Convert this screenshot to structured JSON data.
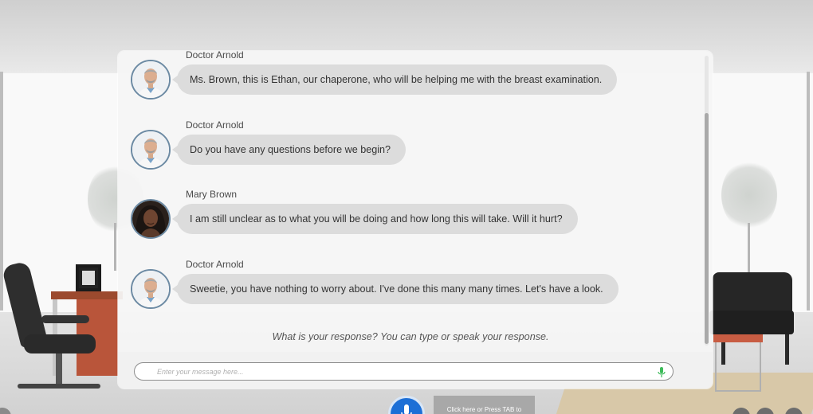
{
  "messages": [
    {
      "sender": "Doctor Arnold",
      "text": "Ms. Brown, this is Ethan, our chaperone, who will be helping me with the breast examination.",
      "avatar": "doctor-avatar"
    },
    {
      "sender": "Doctor Arnold",
      "text": "Do you have any questions before we begin?",
      "avatar": "doctor-avatar"
    },
    {
      "sender": "Mary Brown",
      "text": "I am still unclear as to what you will be doing and how long this will take. Will it hurt?",
      "avatar": "patient-avatar"
    },
    {
      "sender": "Doctor Arnold",
      "text": "Sweetie, you have nothing to worry about. I've done this many many times. Let's have a look.",
      "avatar": "doctor-avatar"
    }
  ],
  "prompt": "What is your response? You can type or speak your response.",
  "input": {
    "placeholder": "Enter your message here...",
    "value": "",
    "mic_icon": "microphone-icon"
  },
  "controls": {
    "voice_button_icon": "microphone-icon",
    "tab_hint": "Click here or Press TAB to"
  },
  "colors": {
    "bubble": "#dcdcdc",
    "mic_green": "#3dbb5a",
    "voice_button_blue": "#1d6fd6",
    "avatar_ring": "#6c8aa3"
  }
}
